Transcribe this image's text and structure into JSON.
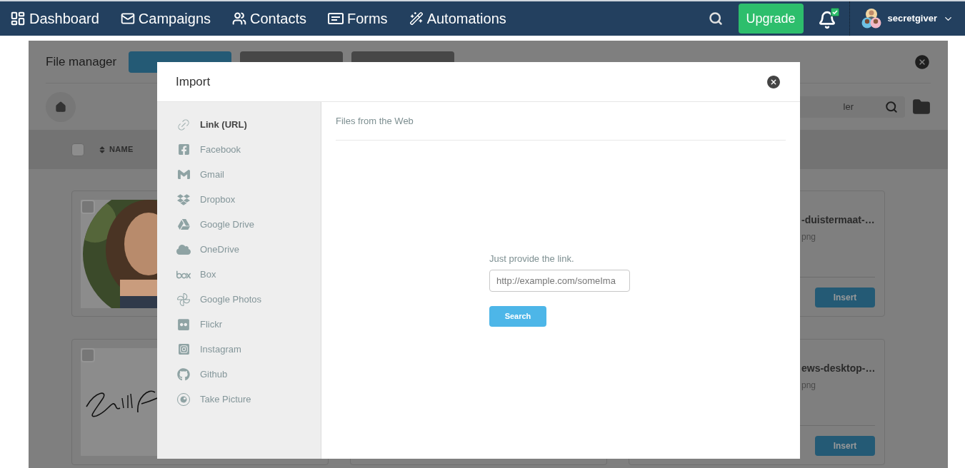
{
  "nav": {
    "items": [
      {
        "label": "Dashboard"
      },
      {
        "label": "Campaigns"
      },
      {
        "label": "Contacts"
      },
      {
        "label": "Forms"
      },
      {
        "label": "Automations"
      }
    ],
    "upgrade": "Upgrade",
    "user": "secretgiver"
  },
  "file_manager": {
    "title": "File manager",
    "search": {
      "placeholder": "ler"
    },
    "select_all": {
      "checked": false
    },
    "column": "NAME",
    "cards": [
      {
        "kind": "picture",
        "checked": false
      },
      {
        "kind": "file",
        "name": "-duistermaat-…",
        "type": "png",
        "action": "Insert"
      },
      {
        "kind": "signature",
        "checked": false
      },
      {
        "kind": "hidden"
      },
      {
        "kind": "file",
        "name": "ews-desktop-…",
        "type": "png",
        "action": "Insert"
      }
    ]
  },
  "dialog": {
    "title": "Import",
    "sources": [
      {
        "label": "Link (URL)",
        "selected": true
      },
      {
        "label": "Facebook",
        "selected": false
      },
      {
        "label": "Gmail",
        "selected": false
      },
      {
        "label": "Dropbox",
        "selected": false
      },
      {
        "label": "Google Drive",
        "selected": false
      },
      {
        "label": "OneDrive",
        "selected": false
      },
      {
        "label": "Box",
        "selected": false
      },
      {
        "label": "Google Photos",
        "selected": false
      },
      {
        "label": "Flickr",
        "selected": false
      },
      {
        "label": "Instagram",
        "selected": false
      },
      {
        "label": "Github",
        "selected": false
      },
      {
        "label": "Take Picture",
        "selected": false
      }
    ],
    "section_title": "Files from the Web",
    "link": {
      "label": "Just provide the link.",
      "placeholder": "http://example.com/someIma"
    },
    "button": "Search"
  }
}
